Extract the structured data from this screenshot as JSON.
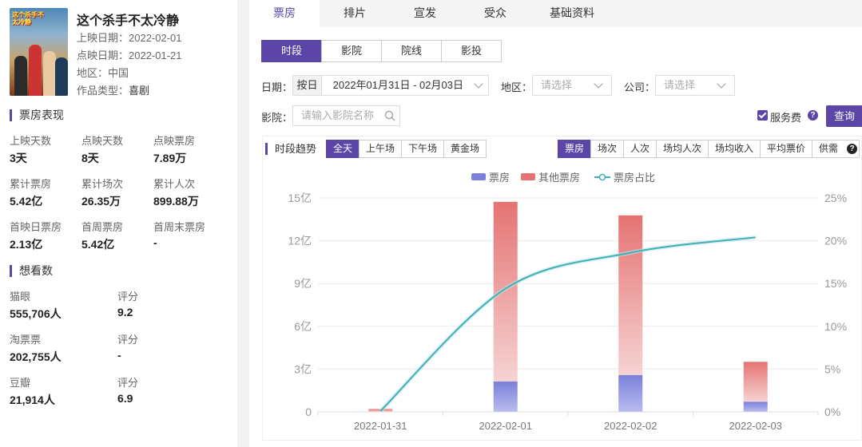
{
  "movie": {
    "title": "这个杀手不太冷静",
    "poster_text": "这个杀手不太冷静",
    "release_date": "上映日期：2022-02-01",
    "preview_date": "点映日期：2022-01-21",
    "region": "地区：中国",
    "genre_label": "作品类型：",
    "genre_value": "喜剧"
  },
  "performance": {
    "title": "票房表现",
    "stats": [
      {
        "label": "上映天数",
        "value": "3天"
      },
      {
        "label": "点映天数",
        "value": "8天"
      },
      {
        "label": "点映票房",
        "value": "7.89万"
      },
      {
        "label": "累计票房",
        "value": "5.42亿"
      },
      {
        "label": "累计场次",
        "value": "26.35万"
      },
      {
        "label": "累计人次",
        "value": "899.88万"
      },
      {
        "label": "首映日票房",
        "value": "2.13亿"
      },
      {
        "label": "首周票房",
        "value": "5.42亿"
      },
      {
        "label": "首周末票房",
        "value": "-"
      }
    ]
  },
  "want": {
    "title": "想看数",
    "rows": [
      {
        "platform": "猫眼",
        "count": "555,706人",
        "score_label": "评分",
        "score": "9.2"
      },
      {
        "platform": "淘票票",
        "count": "202,755人",
        "score_label": "评分",
        "score": "-"
      },
      {
        "platform": "豆瓣",
        "count": "21,914人",
        "score_label": "评分",
        "score": "6.9"
      }
    ]
  },
  "tabs": [
    "票房",
    "排片",
    "宣发",
    "受众",
    "基础资料"
  ],
  "segments": [
    "时段",
    "影院",
    "院线",
    "影投"
  ],
  "filters": {
    "date_label": "日期：",
    "date_mode": "按日",
    "date_range": "2022年01月31日 - 02月03日",
    "region_label": "地区：",
    "region_placeholder": "请选择",
    "company_label": "公司：",
    "company_placeholder": "请选择",
    "cinema_label": "影院：",
    "cinema_placeholder": "请输入影院名称",
    "service_fee": "服务费",
    "help": "?",
    "query": "查询"
  },
  "trend": {
    "title": "时段趋势",
    "periods": [
      "全天",
      "上午场",
      "下午场",
      "黄金场"
    ],
    "metrics": [
      "票房",
      "场次",
      "人次",
      "场均人次",
      "场均收入",
      "平均票价",
      "供需"
    ]
  },
  "colors": {
    "accent": "#5b46a8",
    "bar_boxoffice": "#7b80d9",
    "bar_other": "#e57373",
    "line_share": "#3fb0b8"
  },
  "chart_data": {
    "type": "bar",
    "categories": [
      "2022-01-31",
      "2022-02-01",
      "2022-02-02",
      "2022-02-03"
    ],
    "series": [
      {
        "name": "票房",
        "type": "bar",
        "values": [
          0.0008,
          2.13,
          2.58,
          0.71
        ]
      },
      {
        "name": "其他票房",
        "type": "bar",
        "values": [
          0.2,
          12.6,
          11.2,
          2.8
        ]
      },
      {
        "name": "票房占比",
        "type": "line",
        "axis": "right",
        "values": [
          0.1,
          14.4,
          18.6,
          20.4
        ]
      }
    ],
    "ylim": [
      0,
      15
    ],
    "y_ticks": [
      "0",
      "3亿",
      "6亿",
      "9亿",
      "12亿",
      "15亿"
    ],
    "y2lim": [
      0,
      25
    ],
    "y2_ticks": [
      "0%",
      "5%",
      "10%",
      "15%",
      "20%",
      "25%"
    ],
    "legend_position": "top-center",
    "stacked": true
  }
}
